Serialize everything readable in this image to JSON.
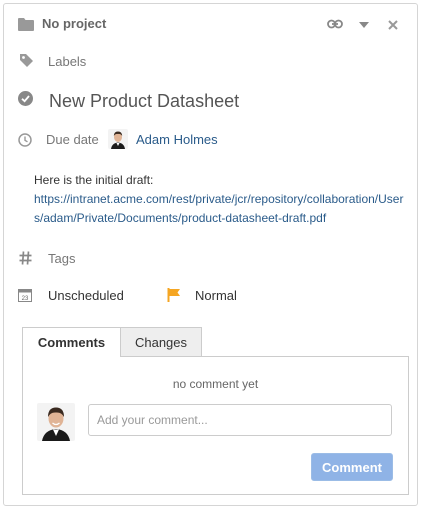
{
  "header": {
    "project": "No project",
    "icons": [
      "folder-icon",
      "link-icon",
      "caret-down-icon",
      "close-icon"
    ]
  },
  "labels": {
    "placeholder": "Labels"
  },
  "task": {
    "title": "New Product Datasheet",
    "status_icon": "check-circle-icon"
  },
  "due": {
    "label": "Due date",
    "assignee": "Adam Holmes"
  },
  "description": {
    "intro": "Here is the initial draft:",
    "url": "https://intranet.acme.com/rest/private/jcr/repository/collaboration/Users/adam/Private/Documents/product-datasheet-draft.pdf"
  },
  "tags": {
    "placeholder": "Tags"
  },
  "schedule": {
    "label": "Unscheduled",
    "calendar_day": "23"
  },
  "priority": {
    "label": "Normal",
    "color": "#f5a623"
  },
  "tabs": [
    {
      "label": "Comments",
      "active": true
    },
    {
      "label": "Changes",
      "active": false
    }
  ],
  "comments": {
    "empty_text": "no comment yet",
    "input_placeholder": "Add your comment...",
    "submit_label": "Comment"
  },
  "colors": {
    "link": "#2a5b8a",
    "button": "#8fb3e6",
    "flag": "#f5a623"
  }
}
